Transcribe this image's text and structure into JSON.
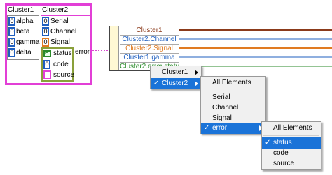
{
  "cluster_control": {
    "outer_label": "Cluster1",
    "inner_label": "Cluster2",
    "cluster1_fields": [
      {
        "value": "0",
        "label": "alpha"
      },
      {
        "value": "0",
        "label": "beta"
      },
      {
        "value": "0",
        "label": "gamma"
      },
      {
        "value": "0",
        "label": "delta"
      }
    ],
    "cluster2_fields": [
      {
        "value": "0",
        "label": "Serial"
      },
      {
        "value": "0",
        "label": "Channel"
      },
      {
        "value": "0",
        "label": "Signal"
      }
    ],
    "error_cluster": {
      "label": "error",
      "status_value": "F",
      "status_label": "status",
      "code_value": "0",
      "code_label": "code",
      "source_label": "source"
    }
  },
  "unbundle_node": {
    "rows": [
      "Cluster1",
      "Cluster2.Channel",
      "Cluster2.Signal",
      "Cluster1.gamma",
      "Cluster2.error.status"
    ]
  },
  "menus": {
    "level1": {
      "items": [
        "Cluster1",
        "Cluster2"
      ],
      "selected": "Cluster2"
    },
    "level2": {
      "header": "All Elements",
      "items": [
        "Serial",
        "Channel",
        "Signal",
        "error"
      ],
      "selected": "error"
    },
    "level3": {
      "header": "All Elements",
      "items": [
        "status",
        "code",
        "source"
      ],
      "selected": "status"
    },
    "check_glyph": "✓"
  },
  "colors": {
    "cluster_border": "#e23fd6",
    "wire_pink": "#d84ad0",
    "numeric_blue": "#1f5fbf",
    "numeric_orange": "#e07b22",
    "status_green": "#2a8a2a",
    "node_yellow": "#fff8d4",
    "menu_highlight": "#1a73d8"
  }
}
